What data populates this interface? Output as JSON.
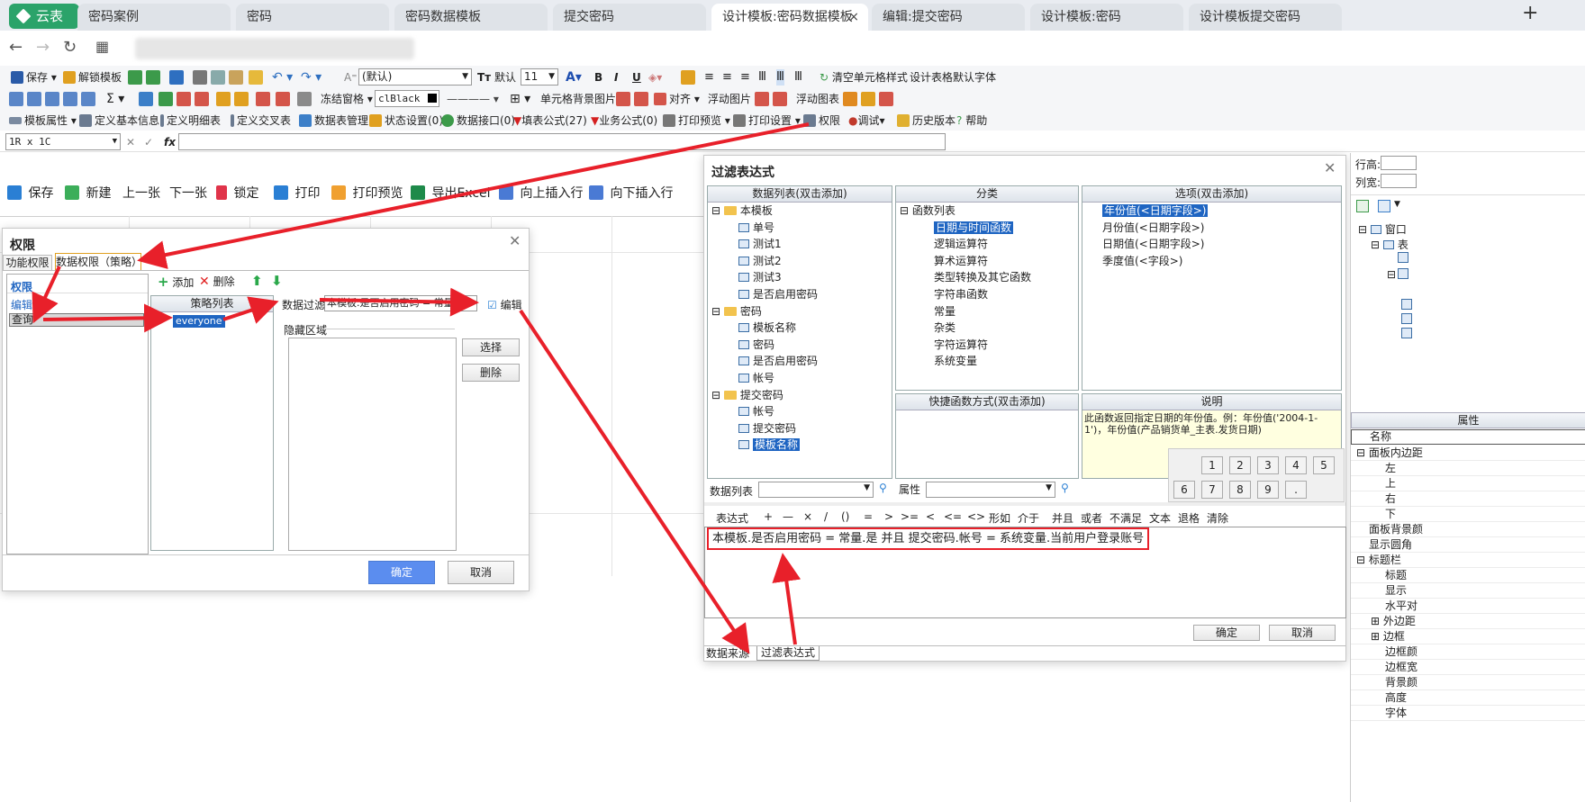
{
  "browser": {
    "logo_label": "云表",
    "tabs": [
      "密码案例",
      "密码",
      "密码数据模板",
      "提交密码",
      "设计模板:密码数据模板",
      "编辑:提交密码",
      "设计模板:密码",
      "设计模板提交密码"
    ],
    "active_tab": 4,
    "tab_close": "×",
    "new_tab": "+"
  },
  "toolbar1": {
    "save": "保存",
    "unlock": "解锁模板",
    "font_name": "(默认)",
    "font_default": "默认",
    "font_size": "11",
    "bold": "B",
    "italic": "I",
    "underline": "U",
    "clear_style": "清空单元格样式",
    "default_font": "设计表格默认字体"
  },
  "toolbar2": {
    "freeze": "冻结窗格",
    "color_value": "clBlack",
    "cell_bg_image": "单元格背景图片",
    "align": "对齐",
    "float_image": "浮动图片",
    "float_chart": "浮动图表"
  },
  "toolbar3": {
    "template_props": "模板属性",
    "define_basic": "定义基本信息",
    "define_detail": "定义明细表",
    "define_cross": "定义交叉表",
    "data_table_mgmt": "数据表管理",
    "status_settings": "状态设置(0)",
    "data_interface": "数据接口(0)",
    "fill_formula": "填表公式(27)",
    "biz_formula": "业务公式(0)",
    "print_preview": "打印预览",
    "print_settings": "打印设置",
    "permission": "权限",
    "debug": "调试",
    "history": "历史版本",
    "help": "帮助"
  },
  "formula_bar": {
    "cell_ref": "1R x 1C",
    "fx": "fx"
  },
  "page_toolbar": [
    "保存",
    "新建",
    "上一张",
    "下一张",
    "锁定",
    "打印",
    "打印预览",
    "导出Excel",
    "向上插入行",
    "向下插入行"
  ],
  "perm_dialog": {
    "title": "权限",
    "tabs": [
      "功能权限",
      "数据权限（策略）"
    ],
    "left_title": "权限",
    "left_items": [
      "编辑",
      "查询"
    ],
    "selected_item": "查询",
    "add": "添加",
    "delete": "删除",
    "policy_header": "策略列表",
    "policy_items": [
      "everyone"
    ],
    "data_filter_label": "数据过滤",
    "data_filter_value": "本模板.是否启用密码 = 常量.是",
    "edit": "编辑",
    "hidden_area": "隐藏区域",
    "select_btn": "选择",
    "delete_btn": "删除",
    "ok": "确定",
    "cancel": "取消"
  },
  "filter_dialog": {
    "title": "过滤表达式",
    "col1_header": "数据列表(双击添加)",
    "col2_header": "分类",
    "col3_header": "选项(双击添加)",
    "tree": [
      {
        "label": "本模板",
        "children": [
          "单号",
          "测试1",
          "测试2",
          "测试3",
          "是否启用密码"
        ]
      },
      {
        "label": "密码",
        "children": [
          "模板名称",
          "密码",
          "是否启用密码",
          "帐号"
        ]
      },
      {
        "label": "提交密码",
        "children": [
          "帐号",
          "提交密码",
          "模板名称"
        ]
      }
    ],
    "selected_leaf": "模板名称",
    "categories_root": "函数列表",
    "categories": [
      "日期与时间函数",
      "逻辑运算符",
      "算术运算符",
      "类型转换及其它函数",
      "字符串函数",
      "常量",
      "杂类",
      "字符运算符",
      "系统变量"
    ],
    "selected_category": "日期与时间函数",
    "options": [
      "年份值(<日期字段>)",
      "月份值(<日期字段>)",
      "日期值(<日期字段>)",
      "季度值(<字段>)"
    ],
    "selected_option": "年份值(<日期字段>)",
    "shortcut_header": "快捷函数方式(双击添加)",
    "desc_header": "说明",
    "desc_text": "此函数返回指定日期的年份值。例：年份值('2004-1-1')，年份值(产品销货单_主表.发货日期)",
    "keypad": [
      "1",
      "2",
      "3",
      "4",
      "5",
      "6",
      "7",
      "8",
      "9",
      "."
    ],
    "data_list_label": "数据列表",
    "prop_label": "属性",
    "ops": [
      "表达式",
      "+",
      "—",
      "×",
      "/",
      "()",
      "=",
      ">",
      ">=",
      "<",
      "<=",
      "<>",
      "形如",
      "介于",
      "并且",
      "或者",
      "不满足",
      "文本",
      "退格",
      "清除"
    ],
    "expression": "本模板.是否启用密码 = 常量.是 并且 提交密码.帐号 = 系统变量.当前用户登录账号",
    "ok": "确定",
    "cancel": "取消",
    "bottom_tabs": [
      "数据来源",
      "过滤表达式"
    ]
  },
  "right_panel": {
    "row_height": "行高:",
    "col_width": "列宽:",
    "window_node": "窗口",
    "table_node": "表",
    "props_header": "属性",
    "name_col": "名称",
    "rows": [
      "面板内边距",
      "左",
      "上",
      "右",
      "下",
      "面板背景颜",
      "显示圆角",
      "标题栏",
      "标题",
      "显示",
      "水平对",
      "外边距",
      "边框",
      "边框颜",
      "边框宽",
      "背景颜",
      "高度",
      "字体"
    ]
  },
  "colors": {
    "accent": "#1f65c2",
    "logo": "#2ba36a",
    "arrow": "#e8202a",
    "ok_button": "#5b8def"
  }
}
